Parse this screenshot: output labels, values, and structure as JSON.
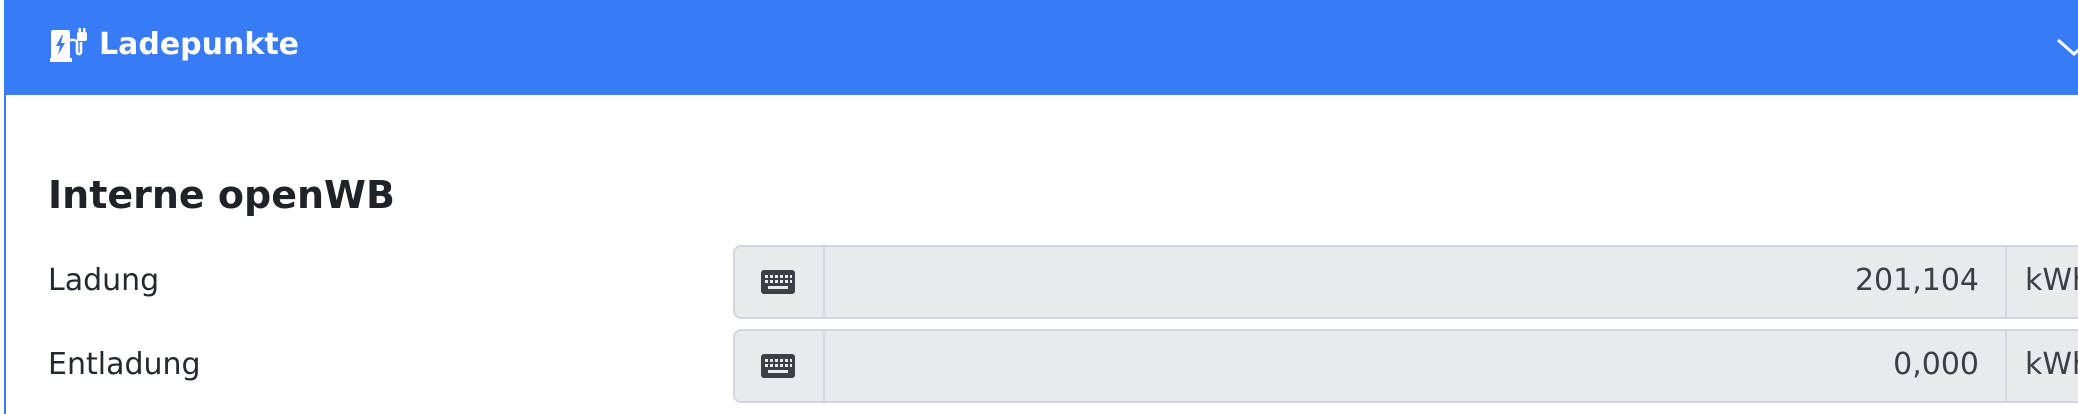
{
  "header": {
    "title": "Ladepunkte",
    "icon": "charging-station-icon",
    "toggle_icon": "chevron-down-icon",
    "background": "#377bf6"
  },
  "section": {
    "title": "Interne openWB"
  },
  "rows": [
    {
      "label": "Ladung",
      "button_icon": "keyboard-icon",
      "value": "201,104",
      "unit": "kWh"
    },
    {
      "label": "Entladung",
      "button_icon": "keyboard-icon",
      "value": "0,000",
      "unit": "kWh"
    }
  ]
}
